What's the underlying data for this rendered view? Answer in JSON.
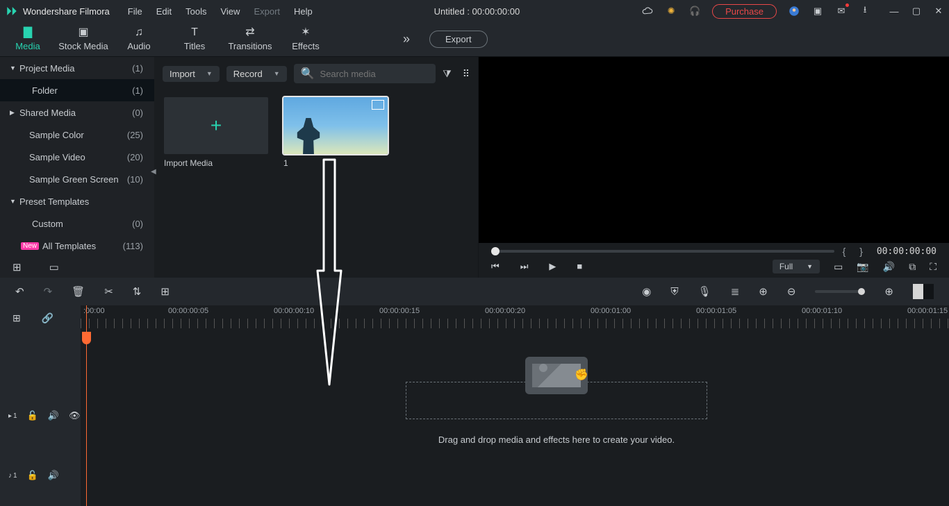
{
  "app": {
    "name": "Wondershare Filmora"
  },
  "menu": {
    "file": "File",
    "edit": "Edit",
    "tools": "Tools",
    "view": "View",
    "export": "Export",
    "help": "Help"
  },
  "title": "Untitled : 00:00:00:00",
  "purchase": "Purchase",
  "tabs": {
    "media": "Media",
    "stock": "Stock Media",
    "audio": "Audio",
    "titles": "Titles",
    "transitions": "Transitions",
    "effects": "Effects",
    "export_btn": "Export"
  },
  "sidebar": {
    "project_media": "Project Media",
    "project_media_count": "(1)",
    "folder": "Folder",
    "folder_count": "(1)",
    "shared_media": "Shared Media",
    "shared_media_count": "(0)",
    "sample_color": "Sample Color",
    "sample_color_count": "(25)",
    "sample_video": "Sample Video",
    "sample_video_count": "(20)",
    "sample_green": "Sample Green Screen",
    "sample_green_count": "(10)",
    "preset_templates": "Preset Templates",
    "custom": "Custom",
    "custom_count": "(0)",
    "all_templates": "All Templates",
    "all_templates_count": "(113)",
    "new_tag": "New"
  },
  "media_toolbar": {
    "import": "Import",
    "record": "Record",
    "search_placeholder": "Search media"
  },
  "media_grid": {
    "import_card": "Import Media",
    "clip1_label": "1"
  },
  "preview": {
    "brackets": "{   }",
    "time": "00:00:00:00",
    "quality": "Full"
  },
  "ruler": {
    "t0": ":00:00",
    "t1": "00:00:00:05",
    "t2": "00:00:00:10",
    "t3": "00:00:00:15",
    "t4": "00:00:00:20",
    "t5": "00:00:01:00",
    "t6": "00:00:01:05",
    "t7": "00:00:01:10",
    "t8": "00:00:01:15"
  },
  "tracks": {
    "video1": "1",
    "audio1": "1"
  },
  "drop_hint": "Drag and drop media and effects here to create your video."
}
